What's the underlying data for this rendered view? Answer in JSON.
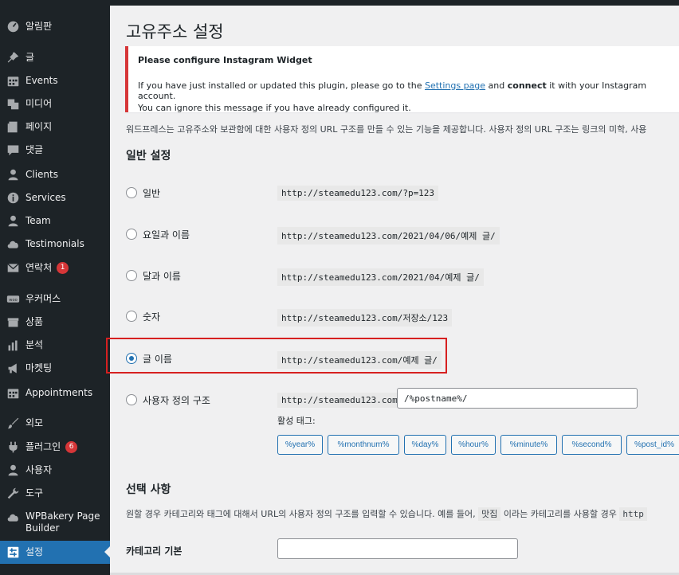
{
  "sidebar": {
    "items": [
      {
        "label": "알림판",
        "icon": "dashboard-icon"
      },
      {
        "label": "글",
        "icon": "pin-icon"
      },
      {
        "label": "Events",
        "icon": "calendar-icon"
      },
      {
        "label": "미디어",
        "icon": "media-icon"
      },
      {
        "label": "페이지",
        "icon": "page-icon"
      },
      {
        "label": "댓글",
        "icon": "comment-icon"
      },
      {
        "label": "Clients",
        "icon": "person-icon"
      },
      {
        "label": "Services",
        "icon": "info-icon"
      },
      {
        "label": "Team",
        "icon": "person-icon"
      },
      {
        "label": "Testimonials",
        "icon": "cloud-icon"
      },
      {
        "label": "연락처",
        "icon": "mail-icon",
        "badge": "1"
      },
      {
        "label": "우커머스",
        "icon": "woo-icon"
      },
      {
        "label": "상품",
        "icon": "archive-icon"
      },
      {
        "label": "분석",
        "icon": "chart-icon"
      },
      {
        "label": "마켓팅",
        "icon": "megaphone-icon"
      },
      {
        "label": "Appointments",
        "icon": "calendar-icon"
      },
      {
        "label": "외모",
        "icon": "brush-icon"
      },
      {
        "label": "플러그인",
        "icon": "plugin-icon",
        "badge": "6"
      },
      {
        "label": "사용자",
        "icon": "person-icon"
      },
      {
        "label": "도구",
        "icon": "wrench-icon"
      },
      {
        "label": "WPBakery Page Builder",
        "icon": "cloud-icon"
      },
      {
        "label": "설정",
        "icon": "settings-icon",
        "current": true
      }
    ]
  },
  "page": {
    "title": "고유주소 설정",
    "notice": {
      "title": "Please configure Instagram Widget",
      "line1_pre": "If you have just installed or updated this plugin, please go to the ",
      "line1_link": "Settings page",
      "line1_mid": " and ",
      "line1_bold": "connect",
      "line1_post": " it with your Instagram account.",
      "line2": "You can ignore this message if you have already configured it."
    },
    "intro": "워드프레스는 고유주소와 보관함에 대한 사용자 정의 URL 구조를 만들 수 있는 기능을 제공합니다. 사용자 정의 URL 구조는 링크의 미학, 사용",
    "general_heading": "일반 설정",
    "options": [
      {
        "label": "일반",
        "example": "http://steamedu123.com/?p=123",
        "checked": false
      },
      {
        "label": "요일과 이름",
        "example": "http://steamedu123.com/2021/04/06/예제 글/",
        "checked": false
      },
      {
        "label": "달과 이름",
        "example": "http://steamedu123.com/2021/04/예제 글/",
        "checked": false
      },
      {
        "label": "숫자",
        "example": "http://steamedu123.com/저장소/123",
        "checked": false
      },
      {
        "label": "글 이름",
        "example": "http://steamedu123.com/예제 글/",
        "checked": true
      },
      {
        "label": "사용자 정의 구조",
        "example": "http://steamedu123.com",
        "checked": false
      }
    ],
    "custom_structure_value": "/%postname%/",
    "tags_label": "활성 태그:",
    "tags": [
      "%year%",
      "%monthnum%",
      "%day%",
      "%hour%",
      "%minute%",
      "%second%",
      "%post_id%"
    ],
    "optional_heading": "선택 사항",
    "optional_desc_pre": "원할 경우 카테고리와 태그에 대해서 URL의 사용자 정의 구조를 입력할 수 있습니다. 예를 들어, ",
    "optional_desc_kbd": "맛집",
    "optional_desc_post": " 이라는 카테고리를 사용할 경우 ",
    "optional_desc_code": "http",
    "category_base_label": "카테고리 기본",
    "category_base_value": ""
  }
}
